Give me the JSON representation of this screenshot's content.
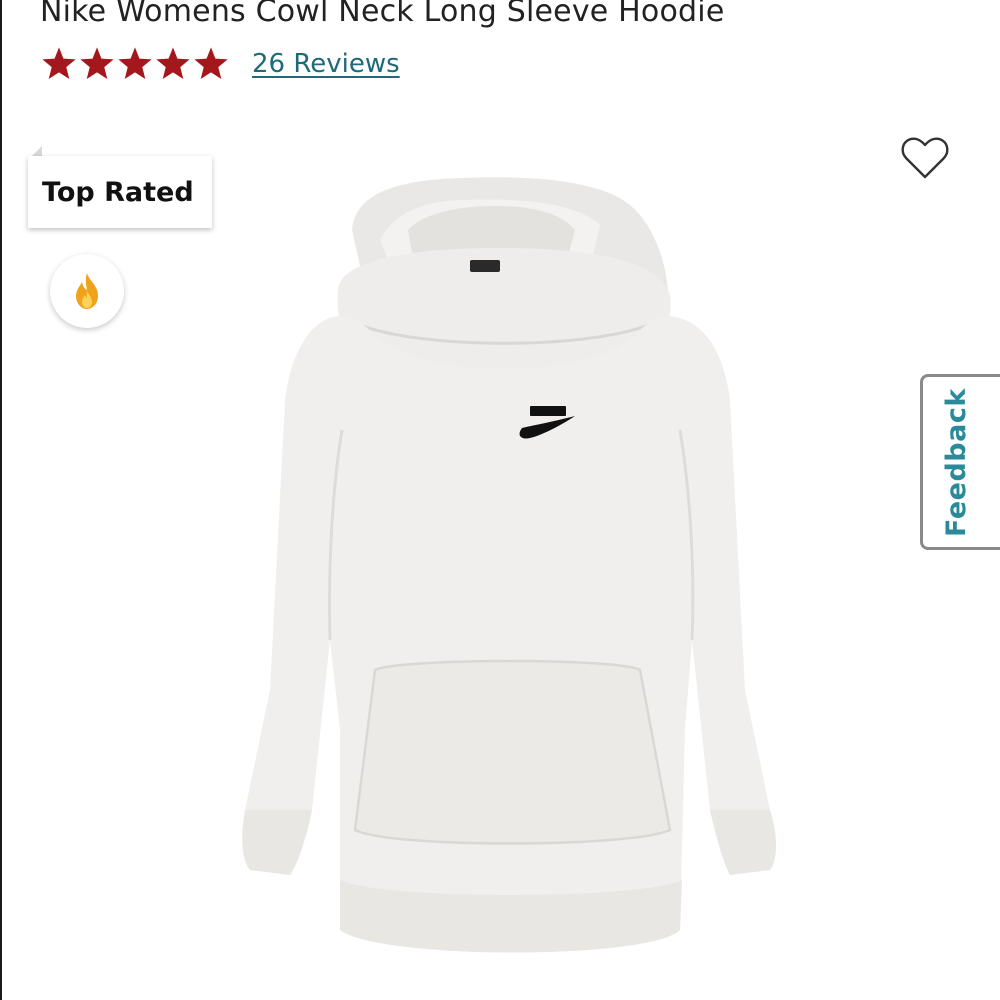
{
  "product": {
    "title": "Nike Womens Cowl Neck Long Sleeve Hoodie",
    "rating": {
      "stars_filled": 5,
      "stars_total": 5,
      "reviews_text": "26 Reviews"
    },
    "badge": {
      "label": "Top Rated"
    },
    "hot_icon": "flame-icon",
    "wishlist_icon": "heart-outline-icon",
    "image_alt": "Nike Womens Cowl Neck Long Sleeve Hoodie"
  },
  "feedback": {
    "label": "Feedback"
  },
  "colors": {
    "star": "#a3171d",
    "link": "#1e6a78",
    "feedback_text": "#2a8a9a",
    "flame_outer": "#f0a21a",
    "flame_inner": "#fbd25a"
  }
}
